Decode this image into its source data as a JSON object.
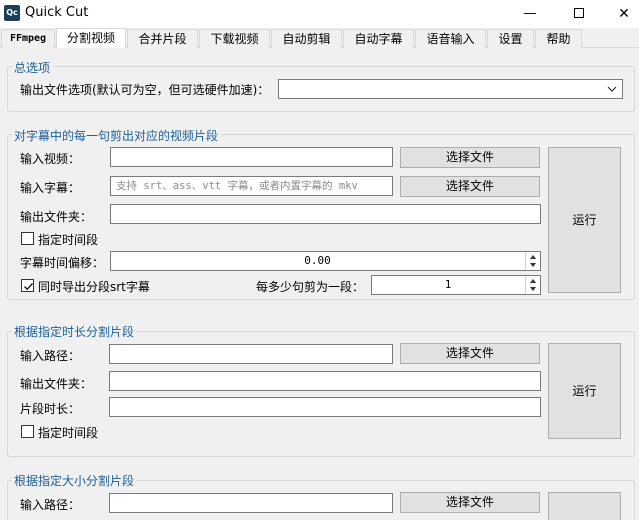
{
  "window": {
    "icon_text": "Qc",
    "title": "Quick Cut",
    "minimize": "—",
    "close": "✕"
  },
  "tabs": [
    {
      "label": "FFmpeg",
      "active": false
    },
    {
      "label": "分割视频",
      "active": true
    },
    {
      "label": "合并片段",
      "active": false
    },
    {
      "label": "下载视频",
      "active": false
    },
    {
      "label": "自动剪辑",
      "active": false
    },
    {
      "label": "自动字幕",
      "active": false
    },
    {
      "label": "语音输入",
      "active": false
    },
    {
      "label": "设置",
      "active": false
    },
    {
      "label": "帮助",
      "active": false
    }
  ],
  "general": {
    "title": "总选项",
    "output_option_label": "输出文件选项(默认可为空，但可选硬件加速)：",
    "output_option_value": ""
  },
  "subtitle_split": {
    "title": "对字幕中的每一句剪出对应的视频片段",
    "input_video_label": "输入视频：",
    "input_video_value": "",
    "input_subtitle_label": "输入字幕：",
    "input_subtitle_placeholder": "支持 srt、ass、vtt 字幕，或者内置字幕的 mkv",
    "output_folder_label": "输出文件夹：",
    "output_folder_value": "",
    "choose_file_label": "选择文件",
    "time_range_label": "指定时间段",
    "time_range_checked": false,
    "offset_label": "字幕时间偏移：",
    "offset_value": "0.00",
    "export_srt_label": "同时导出分段srt字幕",
    "export_srt_checked": true,
    "sentences_per_segment_label": "每多少句剪为一段：",
    "sentences_per_segment_value": "1",
    "run_label": "运行"
  },
  "duration_split": {
    "title": "根据指定时长分割片段",
    "input_path_label": "输入路径：",
    "input_path_value": "",
    "choose_file_label": "选择文件",
    "output_folder_label": "输出文件夹：",
    "output_folder_value": "",
    "segment_duration_label": "片段时长：",
    "segment_duration_value": "",
    "time_range_label": "指定时间段",
    "time_range_checked": false,
    "run_label": "运行"
  },
  "size_split": {
    "title": "根据指定大小分割片段",
    "input_path_label": "输入路径：",
    "input_path_value": "",
    "choose_file_label": "选择文件"
  }
}
